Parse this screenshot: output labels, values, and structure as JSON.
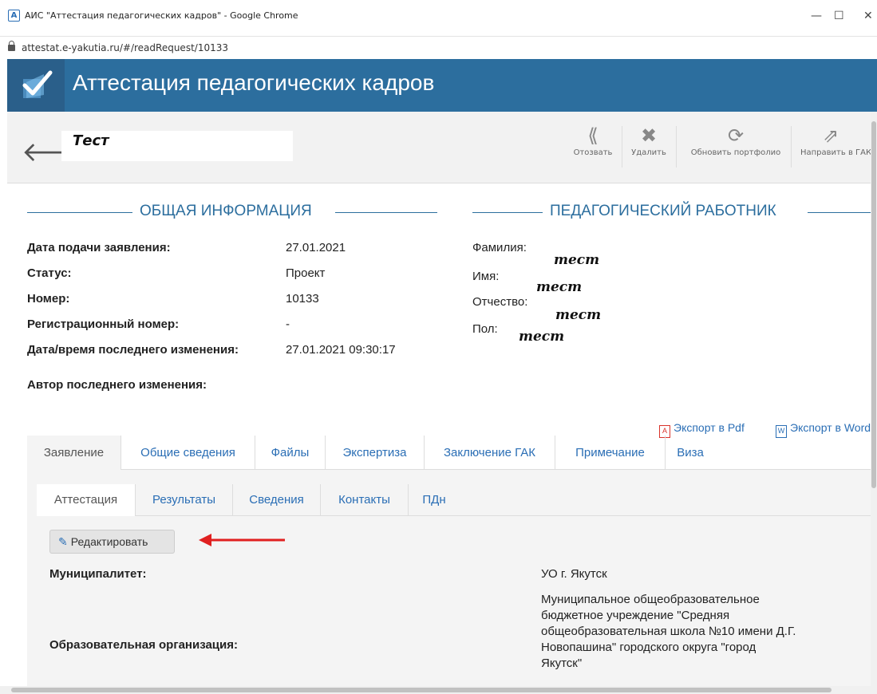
{
  "window": {
    "title": "АИС \"Аттестация педагогических кадров\" - Google Chrome",
    "favicon": "A",
    "minimize": "—",
    "maximize": "☐",
    "close": "✕"
  },
  "browser": {
    "url": "attestat.e-yakutia.ru/#/readRequest/10133"
  },
  "app": {
    "title": "Аттестация педагогических кадров"
  },
  "request": {
    "name": "Тест"
  },
  "toolbar": {
    "withdraw": "Отозвать",
    "delete": "Удалить",
    "refresh": "Обновить портфолио",
    "send": "Направить в ГАК"
  },
  "general": {
    "heading": "ОБЩАЯ ИНФОРМАЦИЯ",
    "rows": [
      {
        "label": "Дата подачи заявления:",
        "value": "27.01.2021"
      },
      {
        "label": "Статус:",
        "value": "Проект"
      },
      {
        "label": "Номер:",
        "value": "10133"
      },
      {
        "label": "Регистрационный номер:",
        "value": "-"
      },
      {
        "label": "Дата/время последнего изменения:",
        "value": "27.01.2021 09:30:17"
      }
    ],
    "author_label": "Автор последнего изменения:"
  },
  "teacher": {
    "heading": "ПЕДАГОГИЧЕСКИЙ РАБОТНИК",
    "labels": [
      "Фамилия:",
      "Имя:",
      "Отчество:",
      "Пол:"
    ],
    "values": [
      "тест",
      "тест",
      "тест",
      "тест"
    ]
  },
  "export": {
    "pdf": "Экспорт в Pdf",
    "word": "Экспорт в Word"
  },
  "tabs": [
    "Заявление",
    "Общие сведения",
    "Файлы",
    "Экспертиза",
    "Заключение ГАК",
    "Примечание",
    "Виза"
  ],
  "subtabs": [
    "Аттестация",
    "Результаты",
    "Сведения",
    "Контакты",
    "ПДн"
  ],
  "edit_button": "Редактировать",
  "fields": {
    "municipality_label": "Муниципалитет:",
    "municipality_value": "УО г. Якутск",
    "org_label": "Образовательная организация:",
    "org_value_lines": [
      "Муниципальное общеобразовательное",
      "бюджетное учреждение \"Средняя",
      "общеобразовательная школа №10 имени Д.Г.",
      "Новопашина\" городского округа \"город",
      "Якутск\""
    ]
  },
  "colors": {
    "accent": "#2c6e9e",
    "link": "#2a6eb5",
    "arrow": "#e02020"
  }
}
